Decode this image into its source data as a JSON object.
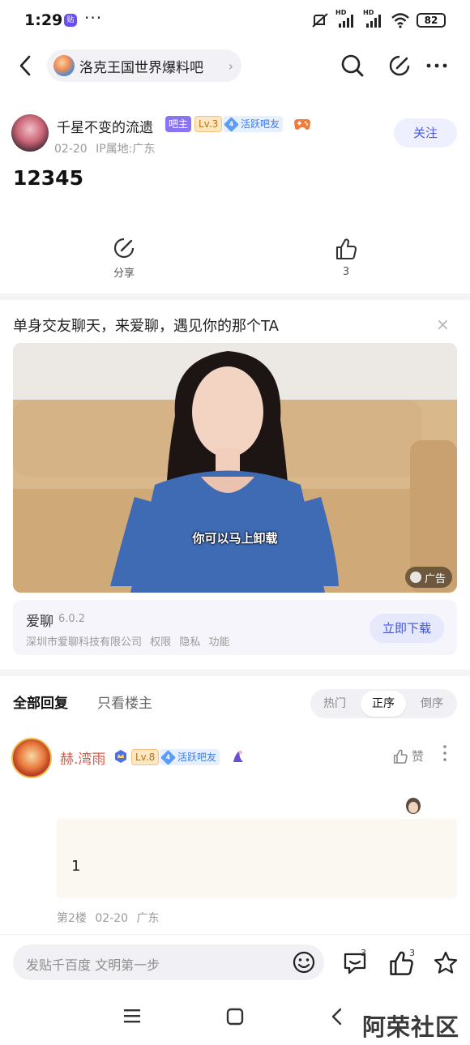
{
  "status_bar": {
    "time": "1:29",
    "app_icon_text": "贴",
    "dots": "···",
    "signal_label_1": "HD",
    "signal_label_2": "HD",
    "battery": "82"
  },
  "nav": {
    "forum_name": "洛克王国世界爆料吧",
    "chevron": "›"
  },
  "post": {
    "author": "千星不变的流遗",
    "badge_admin": "吧主",
    "level": "Lv.3",
    "active_level": "4",
    "active_label": "活跃吧友",
    "date": "02-20",
    "ip_location": "IP属地:广东",
    "follow_label": "关注",
    "content": "12345",
    "share_label": "分享",
    "like_count": "3"
  },
  "ad": {
    "title": "单身交友聊天，来爱聊，遇见你的那个TA",
    "close": "×",
    "caption": "你可以马上卸载",
    "tag": "广告",
    "app_name": "爱聊",
    "app_version": "6.0.2",
    "company": "深圳市爱聊科技有限公司",
    "permissions": "权限",
    "privacy": "隐私",
    "features": "功能",
    "download_label": "立即下载"
  },
  "replies": {
    "tab_all": "全部回复",
    "tab_host": "只看楼主",
    "sort_options": [
      "热门",
      "正序",
      "倒序"
    ],
    "items": [
      {
        "author": "赫.湾雨",
        "level": "Lv.8",
        "active_level": "4",
        "active_label": "活跃吧友",
        "like_label": "赞",
        "content": "1",
        "floor": "第2楼",
        "date": "02-20",
        "location": "广东"
      }
    ]
  },
  "bottom_bar": {
    "compose_placeholder": "发贴千百度 文明第一步",
    "comment_count": "3",
    "like_count": "3"
  },
  "watermark": "阿荣社区",
  "colors": {
    "accent": "#4a5ae0",
    "admin_badge": "#8a74f2",
    "reply_name": "#e5543e",
    "divider": "#f4f4f7"
  }
}
